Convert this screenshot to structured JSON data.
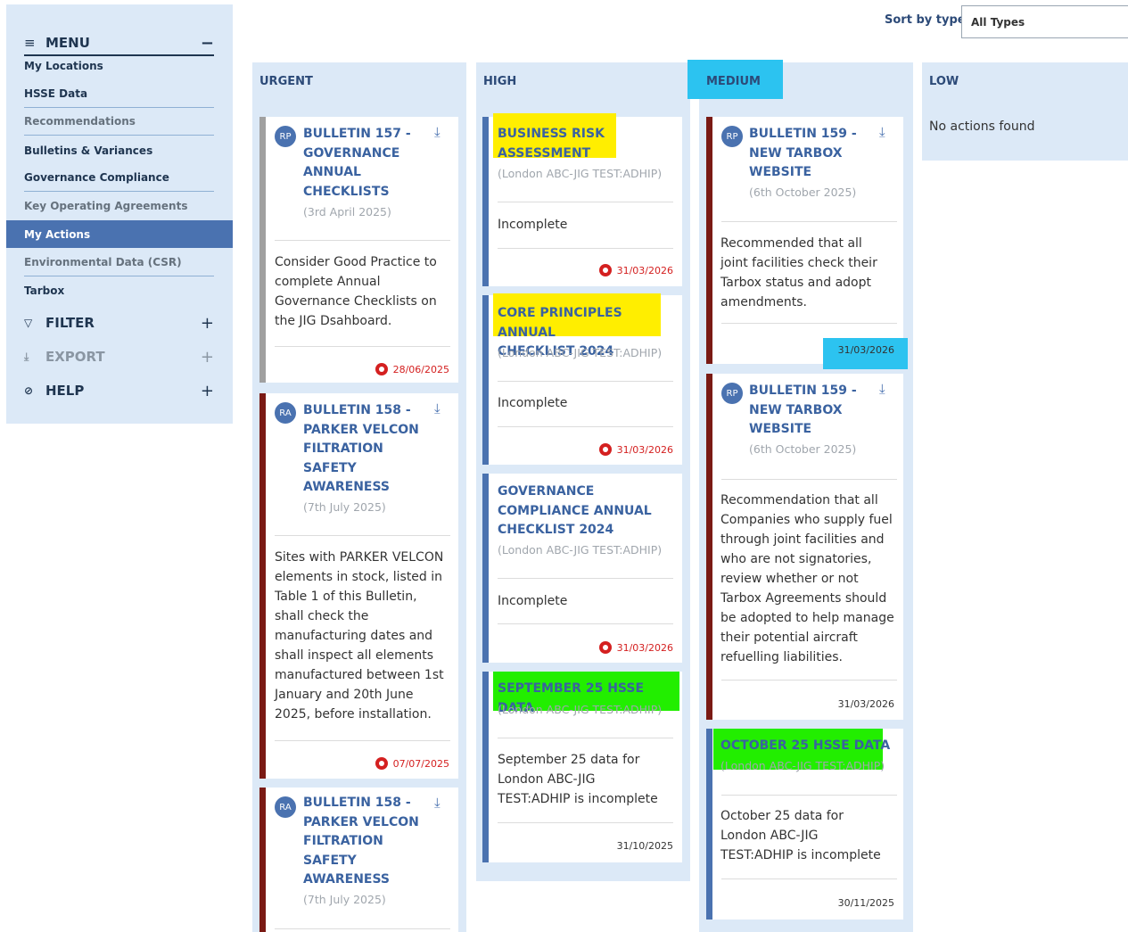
{
  "sidebar": {
    "menu_label": "MENU",
    "items": [
      {
        "label": "My Locations"
      },
      {
        "label": "HSSE Data"
      },
      {
        "label": "Recommendations"
      },
      {
        "label": "Bulletins & Variances"
      },
      {
        "label": "Governance Compliance"
      },
      {
        "label": "Key Operating Agreements"
      },
      {
        "label": "My Actions"
      },
      {
        "label": "Environmental Data (CSR)"
      },
      {
        "label": "Tarbox"
      }
    ],
    "sections": [
      {
        "label": "FILTER",
        "icon": "filter-icon"
      },
      {
        "label": "EXPORT",
        "icon": "download-icon"
      },
      {
        "label": "HELP",
        "icon": "help-icon"
      }
    ]
  },
  "sort": {
    "label": "Sort by type",
    "value": "All Types"
  },
  "columns": {
    "urgent": {
      "title": "URGENT",
      "cards": [
        {
          "avatar": "RP",
          "title": [
            "BULLETIN 157 -",
            "GOVERNANCE",
            "ANNUAL",
            "CHECKLISTS"
          ],
          "subtitle": "(3rd April 2025)",
          "desc": [
            "Consider Good Practice to",
            "complete Annual",
            "Governance Checklists on",
            "the JIG Dsahboard."
          ],
          "date": "28/06/2025"
        },
        {
          "avatar": "RA",
          "title": [
            "BULLETIN 158 -",
            "PARKER VELCON",
            "FILTRATION",
            "SAFETY",
            "AWARENESS"
          ],
          "subtitle": "(7th July 2025)",
          "desc": [
            "Sites with PARKER VELCON",
            "elements in stock, listed in",
            "Table 1 of this Bulletin,",
            "shall check the",
            "manufacturing dates and",
            "shall inspect all elements",
            "manufactured between 1st",
            "January and 20th June",
            "2025, before installation."
          ],
          "date": "07/07/2025"
        },
        {
          "avatar": "RA",
          "title": [
            "BULLETIN 158 -",
            "PARKER VELCON",
            "FILTRATION",
            "SAFETY",
            "AWARENESS"
          ],
          "subtitle": "(7th July 2025)"
        }
      ]
    },
    "high": {
      "title": "HIGH",
      "cards": [
        {
          "title": [
            "BUSINESS RISK",
            "ASSESSMENT"
          ],
          "subtitle": "(London ABC-JIG TEST:ADHIP)",
          "desc": [
            "Incomplete"
          ],
          "date": "31/03/2026"
        },
        {
          "title": [
            "CORE PRINCIPLES ANNUAL",
            "CHECKLIST 2024"
          ],
          "subtitle": "(London ABC-JIG TEST:ADHIP)",
          "desc": [
            "Incomplete"
          ],
          "date": "31/03/2026"
        },
        {
          "title": [
            "GOVERNANCE",
            "COMPLIANCE ANNUAL",
            "CHECKLIST 2024"
          ],
          "subtitle": "(London ABC-JIG TEST:ADHIP)",
          "desc": [
            "Incomplete"
          ],
          "date": "31/03/2026"
        },
        {
          "title": [
            "SEPTEMBER 25 HSSE DATA"
          ],
          "subtitle": "(London ABC-JIG TEST:ADHIP)",
          "desc": [
            "September 25 data for",
            "London ABC-JIG",
            "TEST:ADHIP is incomplete"
          ],
          "date": "31/10/2025"
        }
      ]
    },
    "medium": {
      "title": "MEDIUM",
      "cards": [
        {
          "avatar": "RP",
          "title": [
            "BULLETIN 159 -",
            "NEW TARBOX",
            "WEBSITE"
          ],
          "subtitle": "(6th October 2025)",
          "desc": [
            "Recommended that all",
            "joint facilities check their",
            "Tarbox status and adopt",
            "amendments."
          ],
          "date": "31/03/2026"
        },
        {
          "avatar": "RP",
          "title": [
            "BULLETIN 159 -",
            "NEW TARBOX",
            "WEBSITE"
          ],
          "subtitle": "(6th October 2025)",
          "desc": [
            "Recommendation that all",
            "Companies who supply fuel",
            "through joint facilities and",
            "who are not signatories,",
            "review whether or not",
            "Tarbox Agreements should",
            "be adopted to help manage",
            "their potential aircraft",
            "refuelling liabilities."
          ],
          "date": "31/03/2026"
        },
        {
          "title": [
            "OCTOBER 25 HSSE DATA"
          ],
          "subtitle": "(London ABC-JIG TEST:ADHIP)",
          "desc": [
            "October 25 data for",
            "London ABC-JIG",
            "TEST:ADHIP is incomplete"
          ],
          "date": "30/11/2025"
        }
      ]
    },
    "low": {
      "title": "LOW",
      "empty": "No actions found"
    }
  }
}
